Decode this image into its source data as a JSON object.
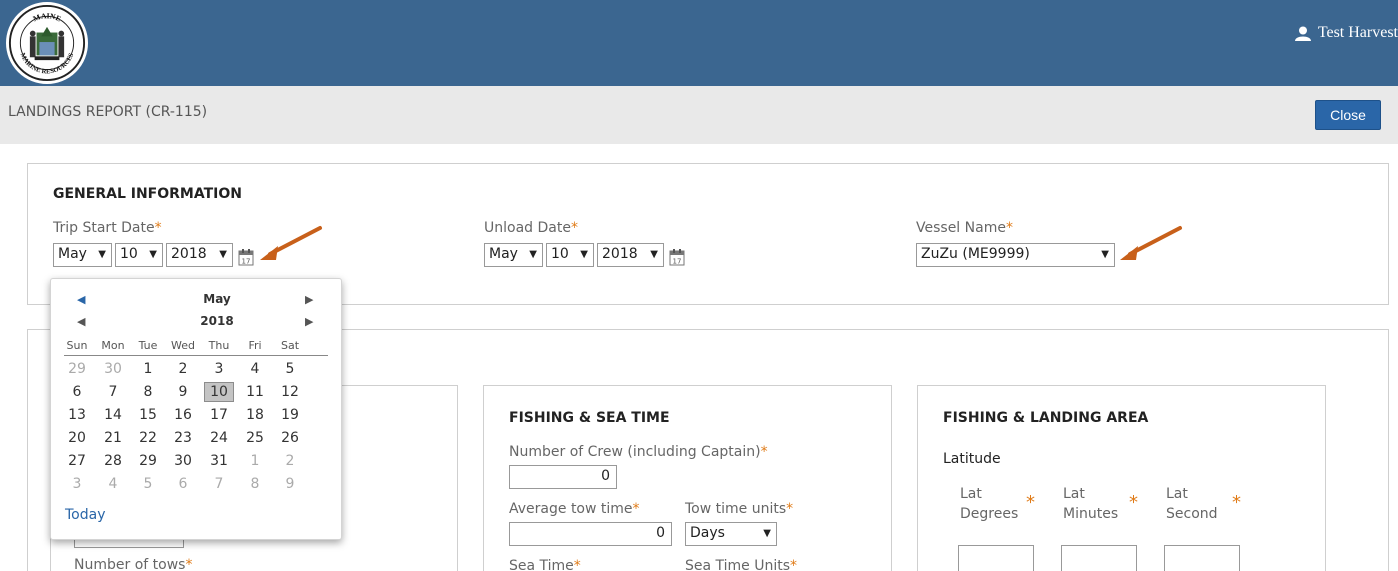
{
  "header": {
    "seal_top_text": "MAINE",
    "seal_bottom_text": "MARINE RESOURCES",
    "user_name": "Test Harvest"
  },
  "subheader": {
    "title": "LANDINGS REPORT (CR-115)",
    "close_label": "Close"
  },
  "general": {
    "heading": "GENERAL INFORMATION",
    "trip_start": {
      "label": "Trip Start Date",
      "month": "May",
      "day": "10",
      "year": "2018"
    },
    "unload": {
      "label": "Unload Date",
      "month": "May",
      "day": "10",
      "year": "2018"
    },
    "vessel": {
      "label": "Vessel Name",
      "value": "ZuZu (ME9999)"
    },
    "required_mark": "*"
  },
  "left_panel": {
    "tows_label_partial": "Number of tows"
  },
  "fishing_sea_time": {
    "heading": "FISHING & SEA TIME",
    "crew_label": "Number of Crew (including Captain)",
    "crew_value": "0",
    "avg_tow_label": "Average tow time",
    "avg_tow_value": "0",
    "tow_units_label": "Tow time units",
    "tow_units_value": "Days",
    "sea_time_label": "Sea Time",
    "sea_time_units_label": "Sea Time Units"
  },
  "landing_area": {
    "heading": "FISHING & LANDING AREA",
    "latitude_label": "Latitude",
    "lat_degrees": [
      "Lat",
      "Degrees"
    ],
    "lat_minutes": [
      "Lat",
      "Minutes"
    ],
    "lat_second": [
      "Lat",
      "Second"
    ]
  },
  "calendar": {
    "month": "May",
    "year": "2018",
    "weekdays": [
      "Sun",
      "Mon",
      "Tue",
      "Wed",
      "Thu",
      "Fri",
      "Sat"
    ],
    "weeks": [
      [
        "29",
        "30",
        "1",
        "2",
        "3",
        "4",
        "5"
      ],
      [
        "6",
        "7",
        "8",
        "9",
        "10",
        "11",
        "12"
      ],
      [
        "13",
        "14",
        "15",
        "16",
        "17",
        "18",
        "19"
      ],
      [
        "20",
        "21",
        "22",
        "23",
        "24",
        "25",
        "26"
      ],
      [
        "27",
        "28",
        "29",
        "30",
        "31",
        "1",
        "2"
      ],
      [
        "3",
        "4",
        "5",
        "6",
        "7",
        "8",
        "9"
      ]
    ],
    "selected_day": "10",
    "today_label": "Today",
    "accent_color": "#2a66a8"
  },
  "colors": {
    "header_bg": "#3b6690",
    "required_star": "#e07b17",
    "annotation_arrow": "#c8601a"
  }
}
